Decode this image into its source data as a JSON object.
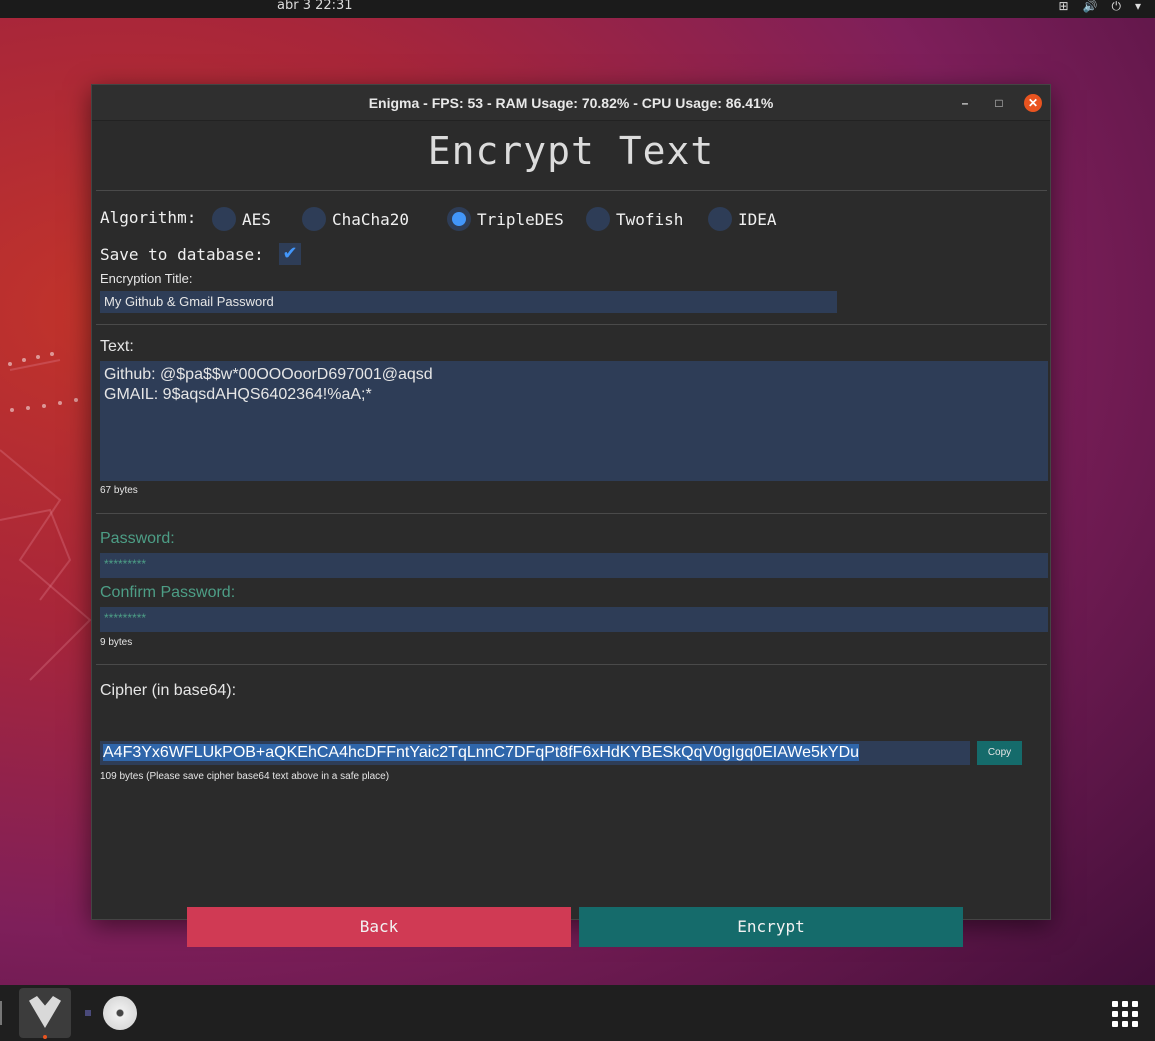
{
  "topbar": {
    "clock": "abr 3  22:31"
  },
  "window": {
    "title": "Enigma - FPS: 53 - RAM Usage: 70.82% - CPU Usage: 86.41%",
    "minimize": "–",
    "maximize": "□",
    "close": "✕"
  },
  "page": {
    "heading": "Encrypt Text",
    "algorithm_label": "Algorithm:",
    "algorithms": [
      "AES",
      "ChaCha20",
      "TripleDES",
      "Twofish",
      "IDEA"
    ],
    "selected_algorithm": "TripleDES",
    "save_label": "Save to database:",
    "save_checked": true,
    "checkmark": "✔",
    "title_label": "Encryption Title:",
    "title_value": "My Github & Gmail Password",
    "text_label": "Text:",
    "text_line1": "Github: @$pa$$w*00OOOoorD697001@aqsd",
    "text_line2": "GMAIL: 9$aqsdAHQS6402364!%aA;*",
    "text_bytes": "67 bytes",
    "password_label": "Password:",
    "password_value": "*********",
    "confirm_label": "Confirm Password:",
    "confirm_value": "*********",
    "password_bytes": "9 bytes",
    "cipher_label": "Cipher (in base64):",
    "cipher_value": "A4F3Yx6WFLUkPOB+aQKEhCA4hcDFFntYaic2TqLnnC7DFqPt8fF6xHdKYBESkQqV0gIgq0EIAWe5kYDu",
    "copy_label": "Copy",
    "cipher_bytes": "109 bytes (Please save cipher base64 text above in a safe place)",
    "back_label": "Back",
    "encrypt_label": "Encrypt"
  },
  "colors": {
    "accent_blue": "#4296fa",
    "field_bg": "#2e3d57",
    "back_button": "#d03a54",
    "encrypt_button": "#156b6b",
    "password_label": "#4d9e86",
    "close_button": "#e95420"
  },
  "tray_icons": [
    "network-icon",
    "volume-icon",
    "power-icon",
    "chevron-down-icon"
  ],
  "dock_icons": [
    "wolf-app-icon",
    "disc-icon",
    "show-apps-icon"
  ]
}
